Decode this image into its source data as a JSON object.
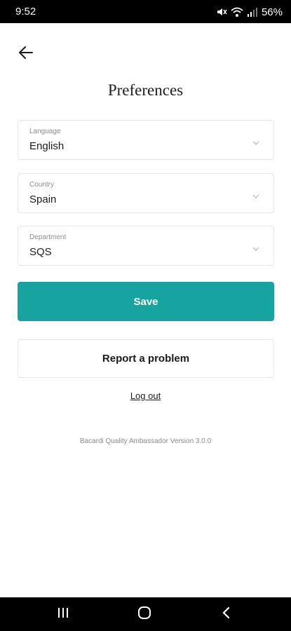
{
  "status_bar": {
    "time": "9:52",
    "battery": "56%",
    "icons": [
      "mute-icon",
      "wifi-icon",
      "signal-icon"
    ]
  },
  "header": {
    "title": "Preferences"
  },
  "form": {
    "language": {
      "label": "Language",
      "value": "English"
    },
    "country": {
      "label": "Country",
      "value": "Spain"
    },
    "department": {
      "label": "Department",
      "value": "SQS"
    }
  },
  "actions": {
    "save_label": "Save",
    "report_label": "Report a problem",
    "logout_label": "Log out"
  },
  "footer": {
    "version": "Bacardi Quality Ambassador Version 3.0.0"
  },
  "colors": {
    "accent": "#17a39f",
    "status_bar": "#000000"
  }
}
